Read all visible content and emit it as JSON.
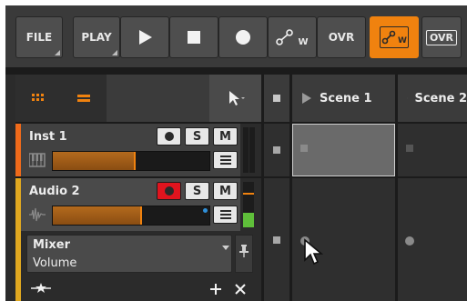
{
  "toolbar": {
    "file_label": "FILE",
    "play_label": "PLAY",
    "ovr_label": "OVR",
    "ovr_active_label": "OVR",
    "automation_write_label": "W",
    "automation_write_active_label": "W"
  },
  "scenes": [
    {
      "label": "Scene 1"
    },
    {
      "label": "Scene 2"
    }
  ],
  "tracks": [
    {
      "name": "Inst 1",
      "color": "#ef6a1a",
      "volume_fraction": 0.52,
      "solo_label": "S",
      "mute_label": "M"
    },
    {
      "name": "Audio 2",
      "color": "#e0a820",
      "volume_fraction": 0.56,
      "solo_label": "S",
      "mute_label": "M"
    }
  ],
  "mixer": {
    "title": "Mixer",
    "parameter": "Volume"
  },
  "colors": {
    "accent": "#f0820f",
    "record_active": "#e0141e",
    "meter_green": "#5fbf3a",
    "clip_selected_bg": "#6a6a6a"
  }
}
